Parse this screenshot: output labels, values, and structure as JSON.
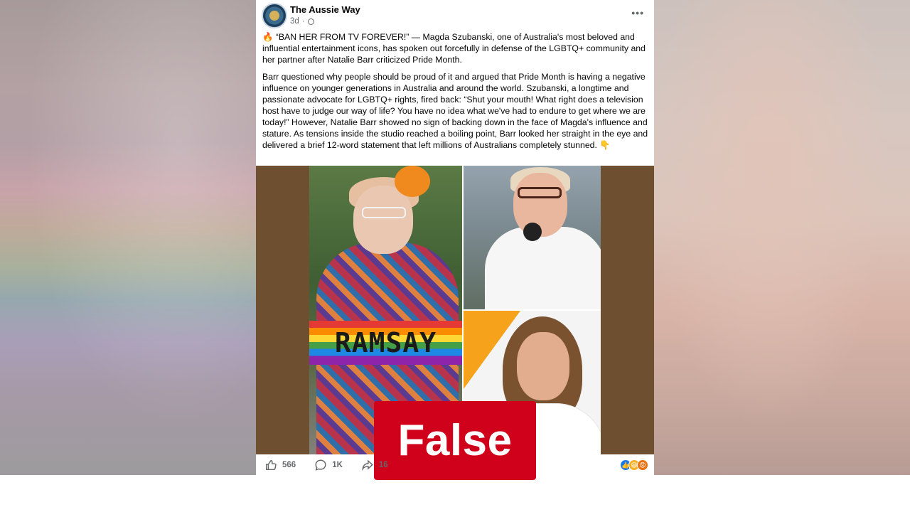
{
  "post": {
    "page_name": "The Aussie Way",
    "time": "3d",
    "more_label": "•••",
    "paragraph1": "🔥 “BAN HER FROM TV FOREVER!” — Magda Szubanski, one of Australia's most beloved and influential entertainment icons, has spoken out forcefully in defense of the LGBTQ+ community and her partner after Natalie Barr criticized Pride Month.",
    "paragraph2": "Barr questioned why people should be proud of it and argued that Pride Month is having a negative influence on younger generations in Australia and around the world. Szubanski, a longtime and passionate advocate for LGBTQ+ rights, fired back: “Shut your mouth! What right does a television host have to judge our way of life? You have no idea what we've had to endure to get where we are today!” However, Natalie Barr showed no sign of backing down in the face of Magda's influence and stature. As tensions inside the studio reached a boiling point, Barr looked her straight in the eye and delivered a brief 12-word statement that left millions of Australians completely stunned. 👇",
    "image": {
      "sign_text": "RAMSAY",
      "badge_text": "False"
    },
    "footer": {
      "likes": "566",
      "comments": "1K",
      "shares": "16",
      "reactions": [
        "like-icon",
        "haha-icon",
        "angry-icon"
      ]
    }
  },
  "colors": {
    "badge_red": "#d0021b",
    "frame_brown": "#6e4f30",
    "meta_gray": "#65676b",
    "like_blue": "#1877f2"
  }
}
